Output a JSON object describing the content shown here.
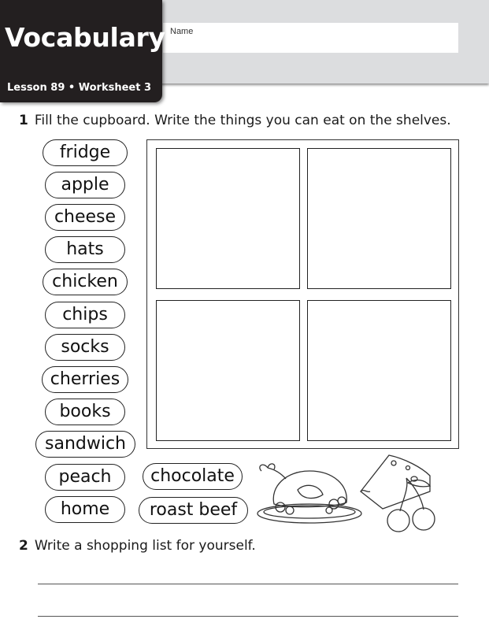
{
  "header": {
    "title": "Vocabulary",
    "subtitle": "Lesson 89 • Worksheet 3",
    "name_label": "Name",
    "name_value": ""
  },
  "question1": {
    "number": "1",
    "text": "Fill the cupboard. Write the things you can eat on the shelves."
  },
  "word_bank": [
    "fridge",
    "apple",
    "cheese",
    "hats",
    "chicken",
    "chips",
    "socks",
    "cherries",
    "books",
    "sandwich",
    "peach",
    "home",
    "chocolate",
    "roast beef"
  ],
  "cupboard": {
    "shelves": [
      "",
      "",
      "",
      ""
    ]
  },
  "illustrations": [
    "roast-chicken-icon",
    "cheese-icon",
    "cherries-icon"
  ],
  "question2": {
    "number": "2",
    "text": "Write a shopping list for yourself.",
    "answer_lines": [
      "",
      ""
    ]
  }
}
